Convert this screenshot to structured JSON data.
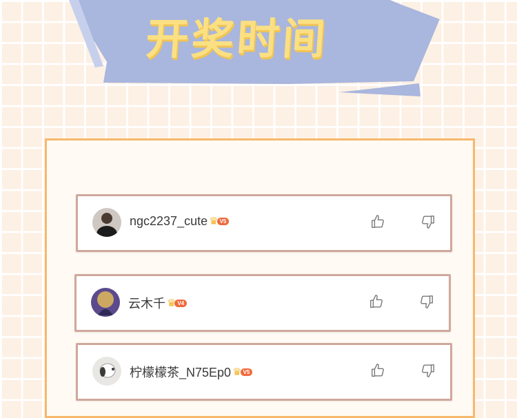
{
  "header": {
    "title": "开奖时间",
    "banner_color": "#a9b6dd",
    "title_color": "#fbe083"
  },
  "comments": [
    {
      "username": "ngc2237_cute",
      "vip_level": "V5",
      "avatar": "dark-portrait",
      "like_icon": "thumbs-up-icon",
      "dislike_icon": "thumbs-down-icon"
    },
    {
      "username": "云木千",
      "vip_level": "V4",
      "avatar": "purple-illustration",
      "like_icon": "thumbs-up-icon",
      "dislike_icon": "thumbs-down-icon"
    },
    {
      "username": "柠檬檬茶_N75Ep0",
      "vip_level": "V5",
      "avatar": "snoopy-dog",
      "like_icon": "thumbs-up-icon",
      "dislike_icon": "thumbs-down-icon"
    }
  ],
  "colors": {
    "background": "#fdf0e4",
    "panel_border": "#f6b86c",
    "row_border": "#cfa89c",
    "vip_badge": "#f06a3c"
  }
}
